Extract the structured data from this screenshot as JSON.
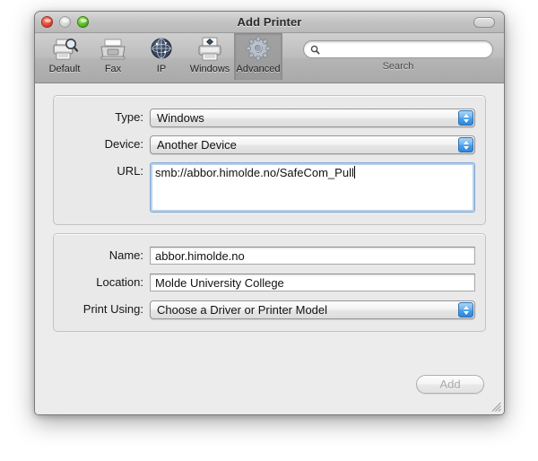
{
  "window": {
    "title": "Add Printer",
    "traffic_lights": [
      "close-button",
      "minimize-button",
      "zoom-button"
    ],
    "toolbar_toggle_label": ""
  },
  "toolbar": {
    "items": [
      {
        "label": "Default",
        "icon": "printer-search-icon",
        "selected": false
      },
      {
        "label": "Fax",
        "icon": "fax-icon",
        "selected": false
      },
      {
        "label": "IP",
        "icon": "globe-icon",
        "selected": false
      },
      {
        "label": "Windows",
        "icon": "printer-network-icon",
        "selected": false
      },
      {
        "label": "Advanced",
        "icon": "gear-icon",
        "selected": true
      }
    ],
    "search": {
      "value": "",
      "placeholder": "",
      "label": "Search",
      "icon": "search-icon"
    }
  },
  "form": {
    "connection": {
      "type": {
        "label": "Type:",
        "value": "Windows"
      },
      "device": {
        "label": "Device:",
        "value": "Another Device"
      },
      "url": {
        "label": "URL:",
        "value": "smb://abbor.himolde.no/SafeCom_Pull"
      }
    },
    "details": {
      "name": {
        "label": "Name:",
        "value": "abbor.himolde.no"
      },
      "location": {
        "label": "Location:",
        "value": "Molde University College"
      },
      "print_using": {
        "label": "Print Using:",
        "value": "Choose a Driver or Printer Model"
      }
    }
  },
  "footer": {
    "add_button": {
      "label": "Add",
      "enabled": false
    }
  },
  "colors": {
    "window_chrome": "#c3c3c3",
    "content_bg": "#ececec",
    "stepper_blue": "#4c9ee8",
    "focus_ring": "#7fa8d4",
    "disabled_text": "#a8a8a8"
  }
}
